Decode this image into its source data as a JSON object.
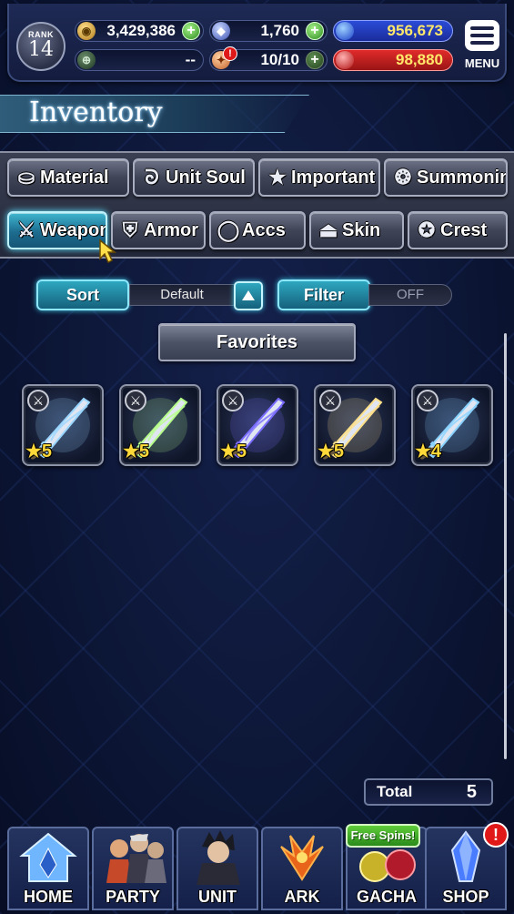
{
  "header": {
    "rank_label": "RANK",
    "rank_value": "14",
    "gil": "3,429,386",
    "lapis": "1,760",
    "blue_currency": "956,673",
    "secondary_value": "--",
    "stamina": "10/10",
    "red_currency": "98,880",
    "alert_glyph": "!",
    "menu_label": "MENU"
  },
  "title": "Inventory",
  "tabs_row1": [
    {
      "label": "Material",
      "icon": "bag-icon"
    },
    {
      "label": "Unit Soul",
      "icon": "soul-icon"
    },
    {
      "label": "Important",
      "icon": "star-icon"
    },
    {
      "label": "Summoning",
      "icon": "summon-icon"
    }
  ],
  "tabs_row2": [
    {
      "label": "Weapon",
      "icon": "sword-icon",
      "active": true
    },
    {
      "label": "Armor",
      "icon": "armor-icon"
    },
    {
      "label": "Accs",
      "icon": "ring-icon"
    },
    {
      "label": "Skin",
      "icon": "hanger-icon"
    },
    {
      "label": "Crest",
      "icon": "crest-icon"
    }
  ],
  "controls": {
    "sort_label": "Sort",
    "sort_value": "Default",
    "filter_label": "Filter",
    "filter_value": "OFF",
    "favorites_label": "Favorites"
  },
  "items": [
    {
      "stars": "★5",
      "name": "weapon-item-1",
      "color": "#9ad6ff"
    },
    {
      "stars": "★5",
      "name": "weapon-item-2",
      "color": "#b7ff8a"
    },
    {
      "stars": "★5",
      "name": "weapon-item-3",
      "color": "#7a6bff"
    },
    {
      "stars": "★5",
      "name": "weapon-item-4",
      "color": "#ffe08a"
    },
    {
      "stars": "★4",
      "name": "weapon-item-5",
      "color": "#8ad2ff"
    }
  ],
  "total": {
    "label": "Total",
    "value": "5"
  },
  "nav": {
    "home": "HOME",
    "party": "PARTY",
    "unit": "UNIT",
    "ark": "ARK",
    "gacha": "GACHA",
    "shop": "SHOP",
    "free_spins": "Free Spins!",
    "shop_alert": "!"
  }
}
